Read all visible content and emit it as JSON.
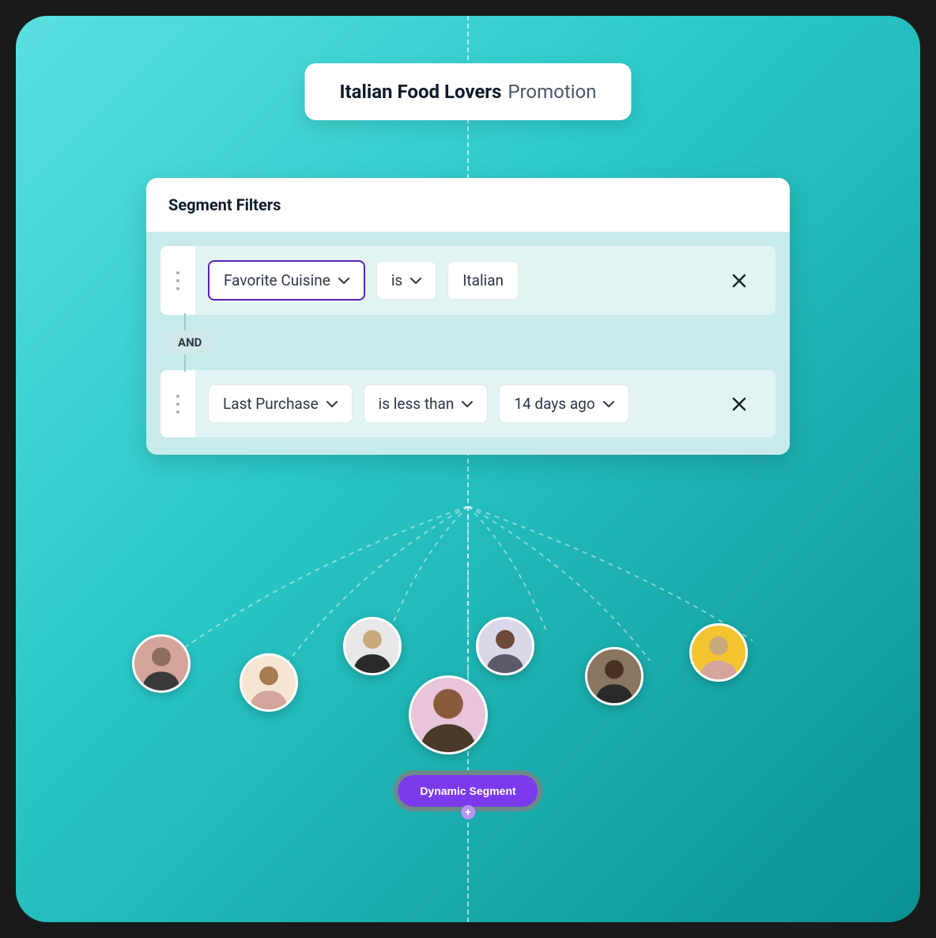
{
  "title": {
    "bold": "Italian Food Lovers",
    "light": "Promotion"
  },
  "filters": {
    "header": "Segment Filters",
    "connector": "AND",
    "rows": [
      {
        "field": "Favorite Cuisine",
        "operator": "is",
        "value": "Italian",
        "highlighted": true
      },
      {
        "field": "Last Purchase",
        "operator": "is less than",
        "value": "14 days ago",
        "highlighted": false
      }
    ]
  },
  "segment_button": "Dynamic Segment",
  "plus_label": "+"
}
